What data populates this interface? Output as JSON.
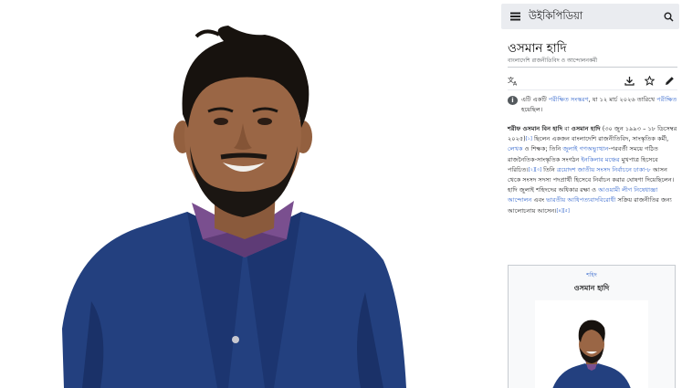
{
  "header": {
    "site_name": "উইকিপিডিয়া",
    "menu_icon": "hamburger-menu-icon",
    "search_icon": "search-icon"
  },
  "article": {
    "title": "ওসমান হাদি",
    "subtitle": "বাংলাদেশি রাজনীতিবিদ ও আন্দোলনকর্মী",
    "tools": {
      "language_icon": "translate-icon",
      "download_icon": "download-icon",
      "watch_icon": "star-icon",
      "edit_icon": "pencil-icon"
    },
    "notice": {
      "text_1": "এটি একটি ",
      "link_1": "পরীক্ষিত সংস্করণ",
      "text_2": ", যা ",
      "date": "১২ মার্চ ২০২৬",
      "text_3": " তারিখে ",
      "link_2": "পরীক্ষিত",
      "text_4": " হয়েছিল।"
    },
    "lead": {
      "name_bold": "শরীফ ওসমান বিন হাদি",
      "text_1": " বা ",
      "alias_bold": "ওসমান হাদি",
      "text_2": " (৩০ জুন ১৯৯৩ – ১৮ ডিসেম্বর ২০২৫)",
      "ref_1": "[১]",
      "text_3": " ছিলেন একজন বাংলাদেশি রাজনীতিবিদ, সাংস্কৃতিক কর্মী, ",
      "link_1": "লেখক",
      "text_4": " ও শিক্ষক; তিনি ",
      "link_2": "জুলাই গণঅভ্যুত্থান",
      "text_5": "-পরবর্তী সময়ে গঠিত রাজনৈতিক-সাংস্কৃতিক সংগঠন ",
      "link_3": "ইনকিলাব মঞ্চের",
      "text_6": " মুখপাত্র হিসেবে পরিচিত।",
      "ref_2": "[২][৩]",
      "text_7": " তিনি ",
      "link_4": "ত্রয়োদশ জাতীয় সংসদ নির্বাচনে ঢাকা-৮",
      "text_8": " আসন থেকে সংসদ সদস্য পদপ্রার্থী হিসেবে নির্বাচন করার ঘোষণা দিয়েছিলেন। হাদি জুলাই শহিদদের অধিকার রক্ষা ও ",
      "link_5": "আওয়ামী লীগ নিষেধাজ্ঞা আন্দোলন",
      "text_9": " এবং ",
      "link_6": "ভারতীয় আধিপত্যবাদবিরোধী",
      "text_10": " সক্রিয় রাজনীতির জন্য আলোচনায় আসেন।",
      "ref_3": "[৪][৫]"
    },
    "infobox": {
      "above": "শহিদ",
      "name": "ওসমান হাদি"
    }
  },
  "colors": {
    "link": "#3366cc",
    "shirt": "#1f3a78",
    "header_bg": "#eaecf0"
  }
}
